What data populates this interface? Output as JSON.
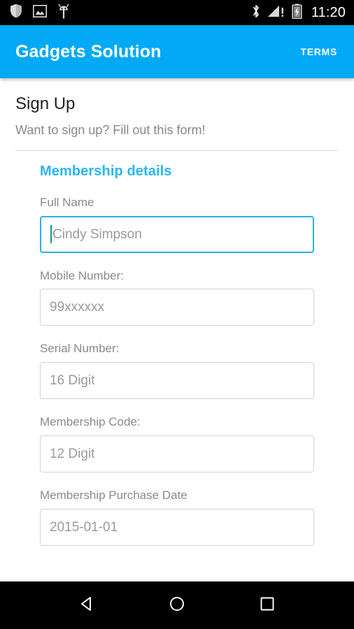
{
  "status_bar": {
    "left_icons": [
      "shield-icon",
      "photo-icon",
      "android-debug-icon"
    ],
    "right_icons": [
      "bluetooth-icon",
      "cellular-signal-alert-icon",
      "battery-charging-icon"
    ],
    "clock": "11:20",
    "background_color": "#000000"
  },
  "app_bar": {
    "title": "Gadgets Solution",
    "action_label": "TERMS",
    "background_color": "#03a9f4",
    "text_color": "#ffffff"
  },
  "page": {
    "title": "Sign Up",
    "subtitle": "Want to sign up? Fill out this form!",
    "section_heading": "Membership details",
    "accent_color": "#29b6f6"
  },
  "form": {
    "fields": [
      {
        "name": "full-name",
        "label": "Full Name",
        "value": "",
        "placeholder": "Cindy Simpson",
        "focused": true,
        "caret_color": "#159588",
        "border_color": "#29b0ef"
      },
      {
        "name": "mobile-number",
        "label": "Mobile Number:",
        "value": "",
        "placeholder": "99xxxxxx",
        "focused": false,
        "border_color": "#d3d3d3"
      },
      {
        "name": "serial-number",
        "label": "Serial Number:",
        "value": "",
        "placeholder": "16 Digit",
        "focused": false,
        "border_color": "#d3d3d3"
      },
      {
        "name": "membership-code",
        "label": "Membership Code:",
        "value": "",
        "placeholder": "12 Digit",
        "focused": false,
        "border_color": "#d3d3d3"
      },
      {
        "name": "membership-purchase-date",
        "label": "Membership Purchase Date",
        "value": "",
        "placeholder": "2015-01-01",
        "focused": false,
        "border_color": "#d3d3d3"
      }
    ]
  },
  "nav_bar": {
    "buttons": [
      "back-icon",
      "home-icon",
      "recents-icon"
    ],
    "background_color": "#000000"
  }
}
